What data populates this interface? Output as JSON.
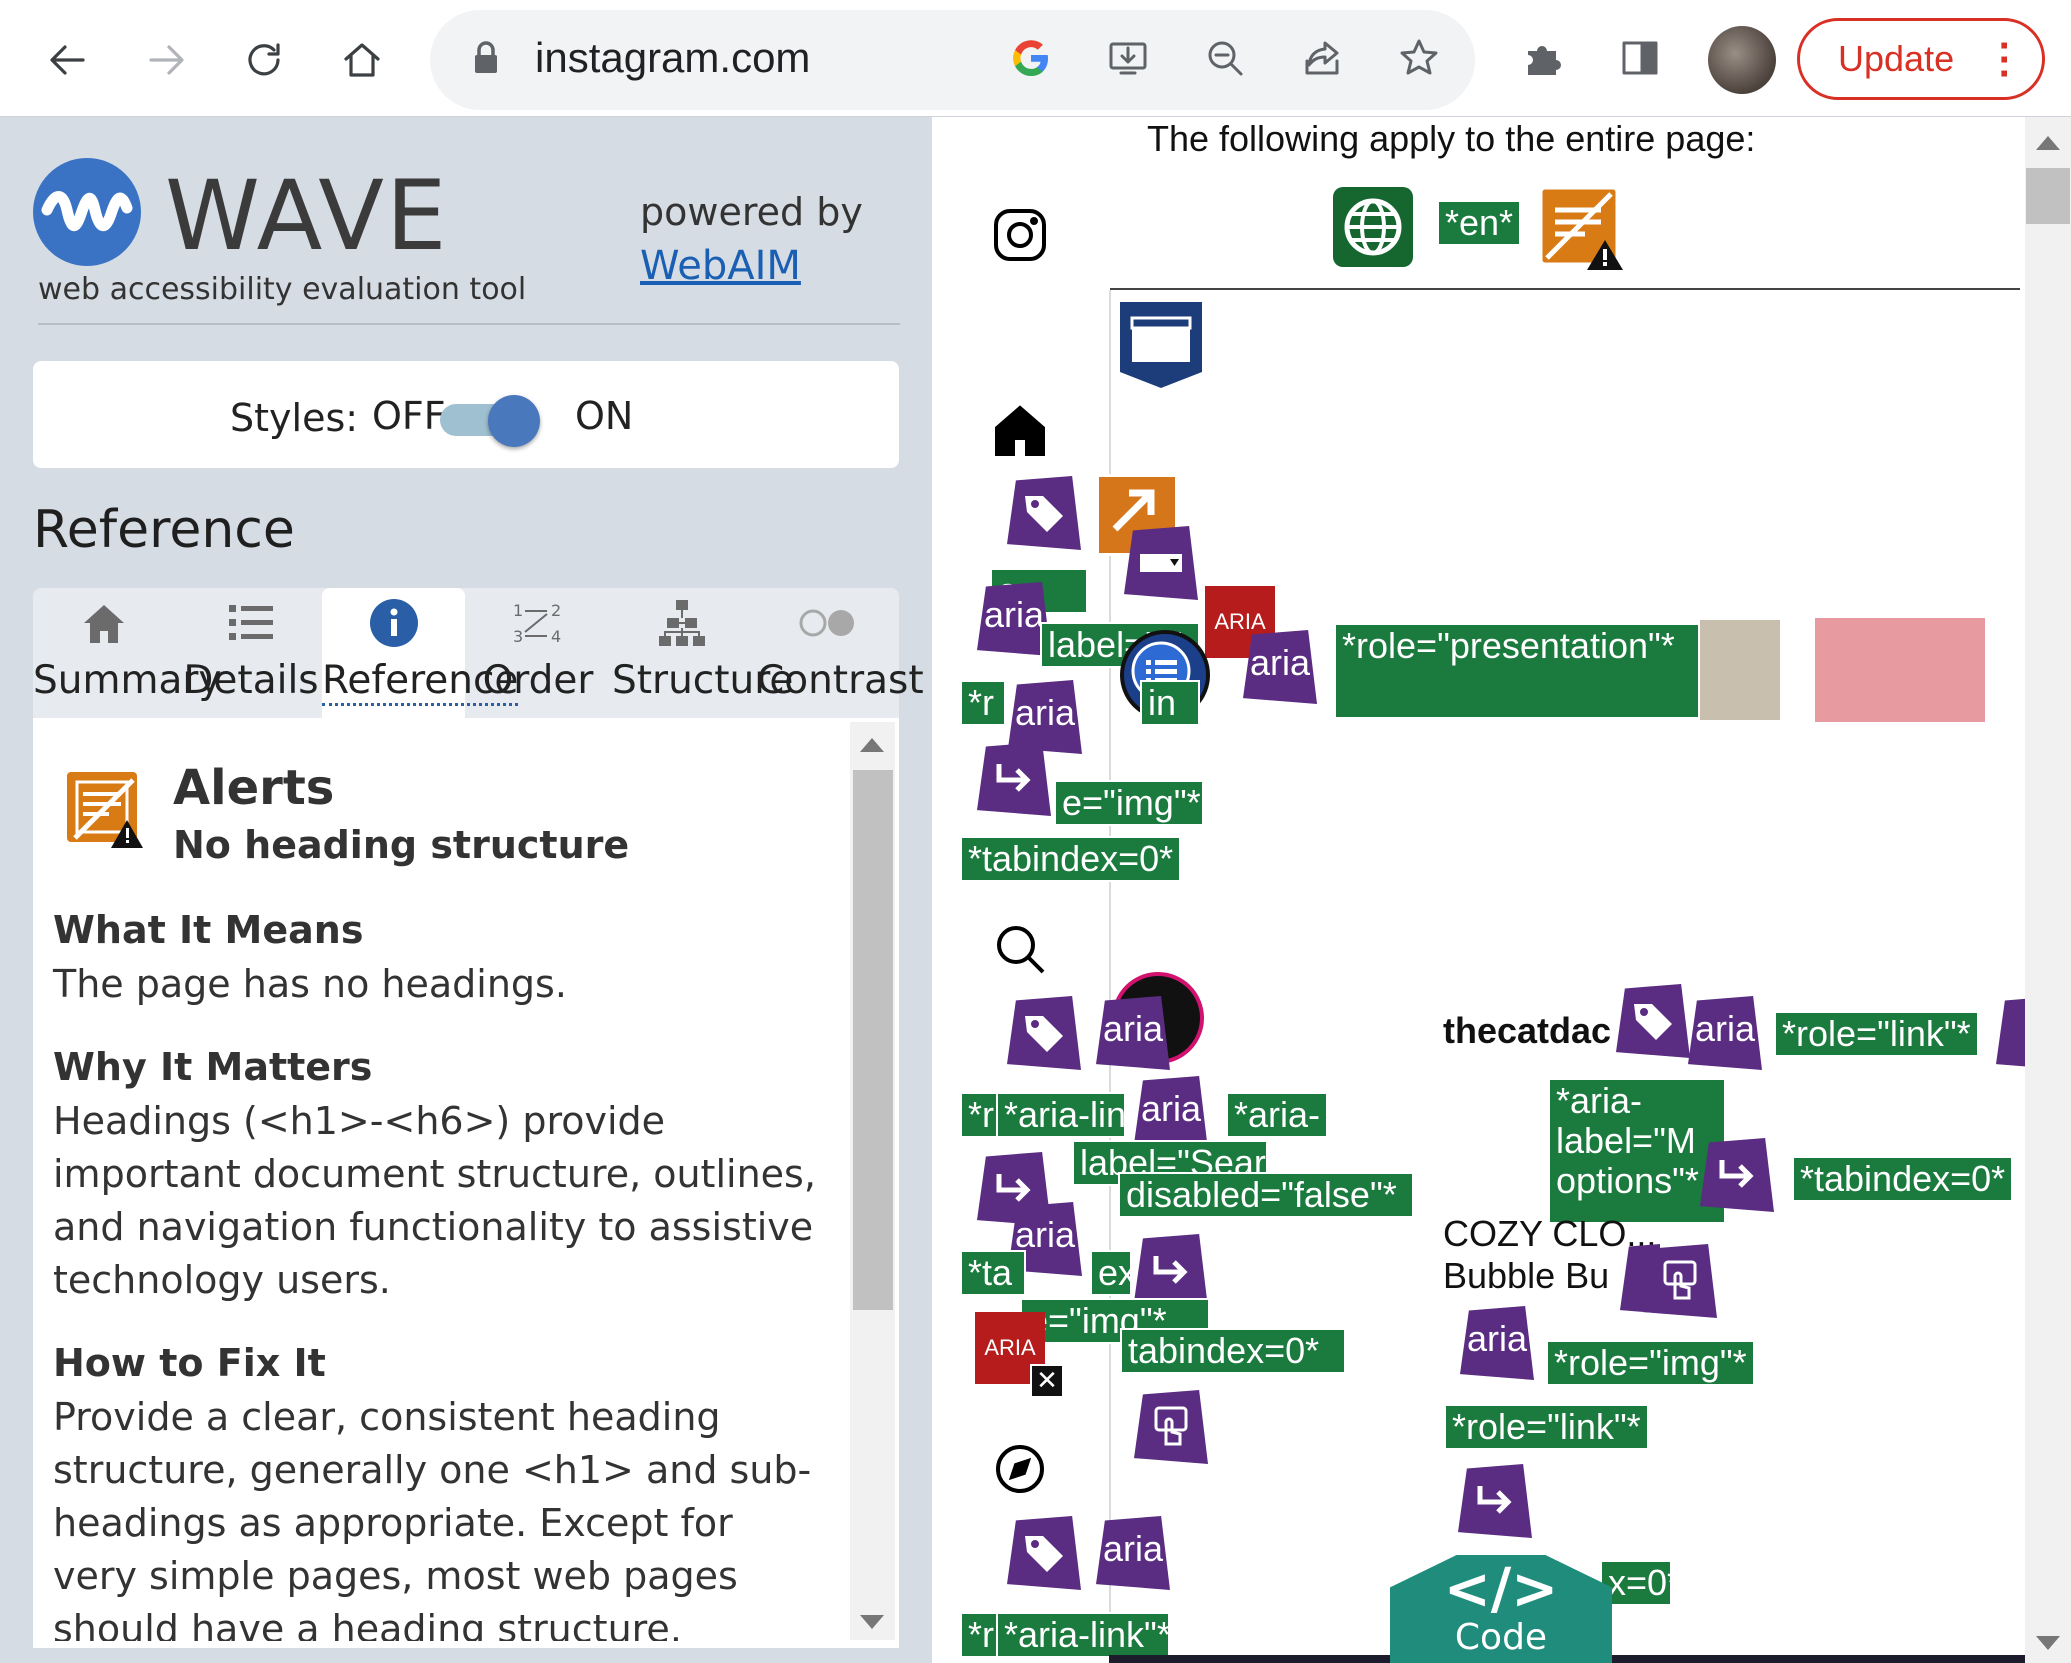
{
  "browser": {
    "url": "instagram.com",
    "update_label": "Update",
    "icons": [
      "back-icon",
      "forward-icon",
      "reload-icon",
      "home-icon",
      "lock-icon",
      "google-icon",
      "install-icon",
      "zoom-out-icon",
      "share-icon",
      "bookmark-star-icon",
      "extensions-icon",
      "side-panel-icon",
      "profile-avatar",
      "menu-dots-icon"
    ]
  },
  "wave": {
    "logo_text": "WAVE",
    "tagline": "web accessibility evaluation tool",
    "powered_by": "powered by",
    "webaim_link": "WebAIM",
    "styles_label": "Styles:",
    "styles_off": "OFF",
    "styles_on": "ON",
    "styles_state": "on",
    "panel_heading": "Reference",
    "tabs": [
      {
        "label": "Summary",
        "icon": "home-icon"
      },
      {
        "label": "Details",
        "icon": "list-icon"
      },
      {
        "label": "Reference",
        "icon": "info-icon",
        "active": true
      },
      {
        "label": "Order",
        "icon": "order-icon"
      },
      {
        "label": "Structure",
        "icon": "structure-icon"
      },
      {
        "label": "Contrast",
        "icon": "contrast-icon"
      }
    ],
    "alert": {
      "category": "Alerts",
      "title": "No heading structure",
      "what_heading": "What It Means",
      "what_text": "The page has no headings.",
      "why_heading": "Why It Matters",
      "why_text": "Headings (<h1>-<h6>) provide important document structure, outlines, and navigation functionality to assistive technology users.",
      "fix_heading": "How to Fix It",
      "fix_text": "Provide a clear, consistent heading structure, generally one <h1> and sub-headings as appropriate. Except for very simple pages, most web pages should have a heading structure."
    }
  },
  "page": {
    "entire_page_text": "The following apply to the entire page:",
    "lang_tag": "*en*",
    "username": "thecatdac",
    "product_line1": "COZY CLO...",
    "product_line2": "Bubble Bu",
    "code_label": "Code",
    "code_symbol": "</>",
    "tags": {
      "role_presentation": "*role=\"presentation\"*",
      "role_img": "*role=\"img\"*",
      "role_link": "*role=\"link\"*",
      "tabindex": "*tabindex=0*",
      "aria_label_search": "label=\"Search\"*",
      "aria_disabled": "disabled=\"false\"*",
      "aria_link": "*aria-link\"*",
      "aria_label_options": "*aria-label=\"M options\"*",
      "aria_label_home": "label=\"H",
      "aria_partial": "*aria-",
      "img_partial": "e=\"img\"*",
      "r_partial": "*r",
      "tab_partial": "*ta",
      "ex_partial": "ex",
      "in_partial": "in",
      "a_partial": "a-",
      "aria_lin_partial": "*aria-lin",
      "tabindex_partial": "tabindex=0*",
      "idx_partial": "x=0*"
    },
    "tile_aria": "aria",
    "tile_ARIA": "ARIA"
  }
}
